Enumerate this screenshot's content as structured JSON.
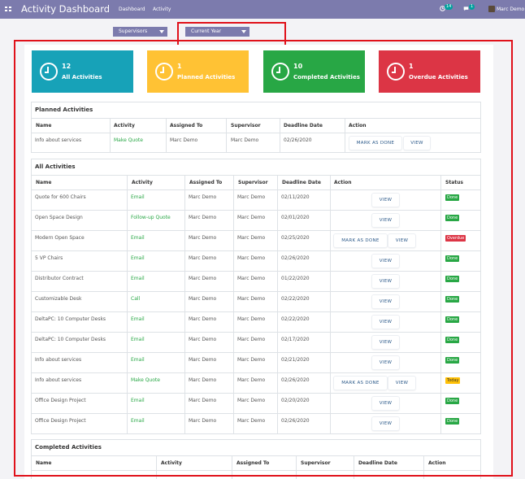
{
  "navbar": {
    "title": "Activity Dashboard",
    "menu": [
      "Dashboard",
      "Activity"
    ],
    "clock_badge": "14",
    "chat_badge": "1",
    "user": "Marc Demo"
  },
  "filters": {
    "supervisors": "Supervisors",
    "period": "Current Year"
  },
  "kpis": [
    {
      "count": "12",
      "label": "All Activities",
      "color": "#17a2b8"
    },
    {
      "count": "1",
      "label": "Planned Activities",
      "color": "#ffc234"
    },
    {
      "count": "10",
      "label": "Completed Activities",
      "color": "#28a745"
    },
    {
      "count": "1",
      "label": "Overdue Activities",
      "color": "#dc3545"
    }
  ],
  "labels": {
    "mark_as_done": "MARK AS DONE",
    "view": "VIEW"
  },
  "planned": {
    "title": "Planned Activities",
    "columns": [
      "Name",
      "Activity",
      "Assigned To",
      "Supervisor",
      "Deadline Date",
      "Action"
    ],
    "rows": [
      {
        "name": "Info about services",
        "activity": "Make Quote",
        "assigned": "Marc Demo",
        "supervisor": "Marc Demo",
        "deadline": "02/26/2020"
      }
    ]
  },
  "all": {
    "title": "All Activities",
    "columns": [
      "Name",
      "Activity",
      "Assigned To",
      "Supervisor",
      "Deadline Date",
      "Action",
      "Status"
    ],
    "rows": [
      {
        "name": "Quote for 600 Chairs",
        "activity": "Email",
        "assigned": "Marc Demo",
        "supervisor": "Marc Demo",
        "deadline": "02/11/2020",
        "mark": false,
        "status": "Done"
      },
      {
        "name": "Open Space Design",
        "activity": "Follow-up Quote",
        "assigned": "Marc Demo",
        "supervisor": "Marc Demo",
        "deadline": "02/01/2020",
        "mark": false,
        "status": "Done"
      },
      {
        "name": "Modern Open Space",
        "activity": "Email",
        "assigned": "Marc Demo",
        "supervisor": "Marc Demo",
        "deadline": "02/25/2020",
        "mark": true,
        "status": "Overdue"
      },
      {
        "name": "5 VP Chairs",
        "activity": "Email",
        "assigned": "Marc Demo",
        "supervisor": "Marc Demo",
        "deadline": "02/26/2020",
        "mark": false,
        "status": "Done"
      },
      {
        "name": "Distributor Contract",
        "activity": "Email",
        "assigned": "Marc Demo",
        "supervisor": "Marc Demo",
        "deadline": "01/22/2020",
        "mark": false,
        "status": "Done"
      },
      {
        "name": "Customizable Desk",
        "activity": "Call",
        "assigned": "Marc Demo",
        "supervisor": "Marc Demo",
        "deadline": "02/22/2020",
        "mark": false,
        "status": "Done"
      },
      {
        "name": "DeltaPC: 10 Computer Desks",
        "activity": "Email",
        "assigned": "Marc Demo",
        "supervisor": "Marc Demo",
        "deadline": "02/22/2020",
        "mark": false,
        "status": "Done"
      },
      {
        "name": "DeltaPC: 10 Computer Desks",
        "activity": "Email",
        "assigned": "Marc Demo",
        "supervisor": "Marc Demo",
        "deadline": "02/17/2020",
        "mark": false,
        "status": "Done"
      },
      {
        "name": "Info about services",
        "activity": "Email",
        "assigned": "Marc Demo",
        "supervisor": "Marc Demo",
        "deadline": "02/21/2020",
        "mark": false,
        "status": "Done"
      },
      {
        "name": "Info about services",
        "activity": "Make Quote",
        "assigned": "Marc Demo",
        "supervisor": "Marc Demo",
        "deadline": "02/26/2020",
        "mark": true,
        "status": "Today"
      },
      {
        "name": "Office Design Project",
        "activity": "Email",
        "assigned": "Marc Demo",
        "supervisor": "Marc Demo",
        "deadline": "02/20/2020",
        "mark": false,
        "status": "Done"
      },
      {
        "name": "Office Design Project",
        "activity": "Email",
        "assigned": "Marc Demo",
        "supervisor": "Marc Demo",
        "deadline": "02/26/2020",
        "mark": false,
        "status": "Done"
      }
    ]
  },
  "completed": {
    "title": "Completed Activities",
    "columns": [
      "Name",
      "Activity",
      "Assigned To",
      "Supervisor",
      "Deadline Date",
      "Action"
    ]
  }
}
